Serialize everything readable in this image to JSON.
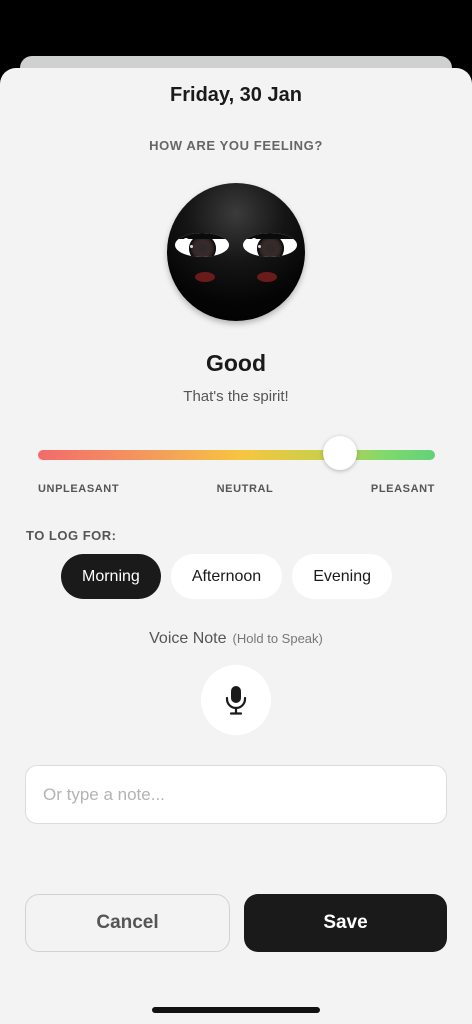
{
  "header": {
    "date": "Friday, 30 Jan",
    "question": "HOW ARE YOU FEELING?"
  },
  "mood": {
    "label": "Good",
    "subtitle": "That's the spirit!",
    "slider_value": 0.76,
    "scale": {
      "left": "UNPLEASANT",
      "center": "NEUTRAL",
      "right": "PLEASANT"
    }
  },
  "log_for": {
    "label": "TO LOG FOR:",
    "options": [
      "Morning",
      "Afternoon",
      "Evening"
    ],
    "selected": "Morning"
  },
  "voice": {
    "title": "Voice Note",
    "hint": "(Hold to Speak)",
    "icon": "microphone-icon"
  },
  "note": {
    "placeholder": "Or type a note...",
    "value": ""
  },
  "actions": {
    "cancel": "Cancel",
    "save": "Save"
  },
  "colors": {
    "background": "#f2f3f2",
    "primary": "#1a1a1a",
    "slider_start": "#f26b6b",
    "slider_mid": "#f6c640",
    "slider_end": "#62d27a"
  }
}
